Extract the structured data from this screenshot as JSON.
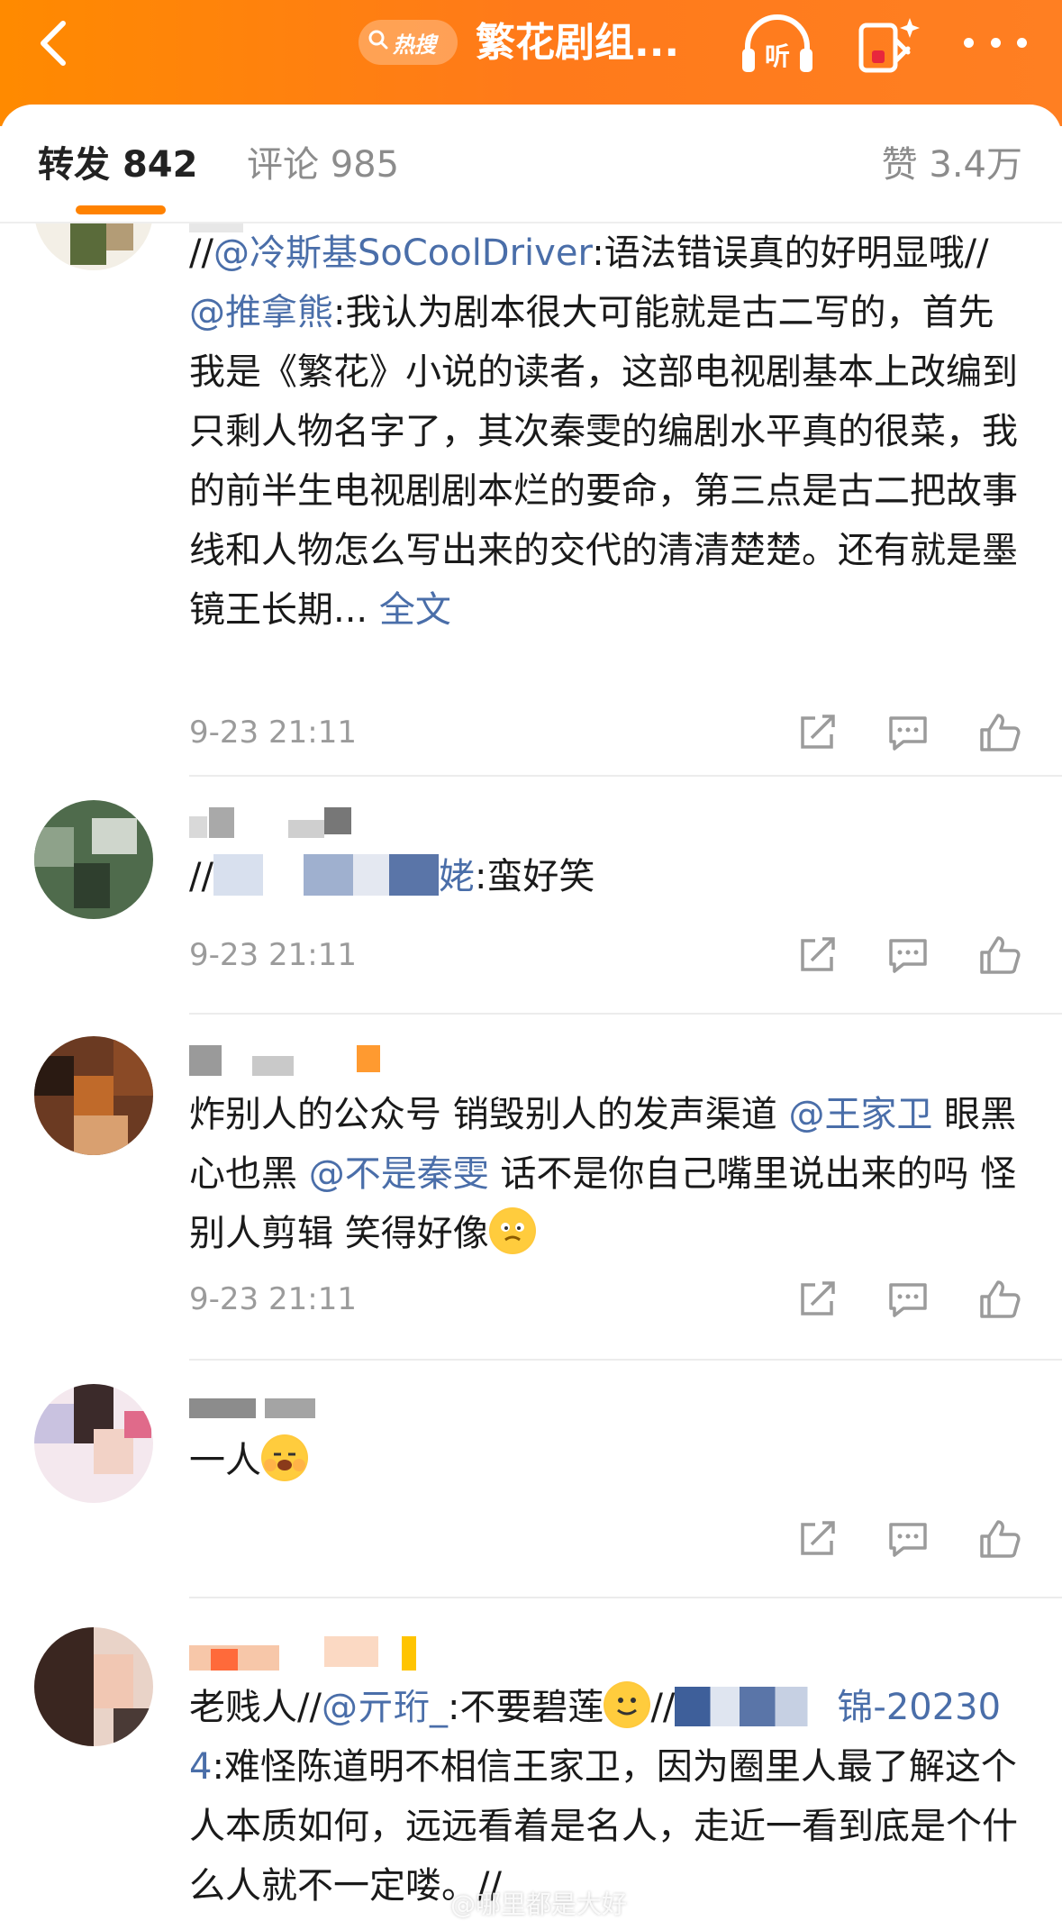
{
  "header": {
    "hot_label": "热搜",
    "title": "繁花剧组...",
    "listen_label": "听"
  },
  "tabs": {
    "repost_label": "转发",
    "repost_count": "842",
    "comment_label": "评论",
    "comment_count": "985",
    "like_label": "赞",
    "like_count": "3.4万"
  },
  "posts": [
    {
      "content_parts": [
        {
          "text": "//",
          "type": "text"
        },
        {
          "text": "@冷斯基SoCoolDriver",
          "type": "mention"
        },
        {
          "text": ":语法错误真的好明显哦//",
          "type": "text"
        },
        {
          "text": "@推拿熊",
          "type": "mention"
        },
        {
          "text": ":我认为剧本很大可能就是古二写的，首先我是《繁花》小说的读者，这部电视剧基本上改编到只剩人物名字了，其次秦雯的编剧水平真的很菜，我的前半生电视剧剧本烂的要命，第三点是古二把故事线和人物怎么写出来的交代的清清楚楚。还有就是墨镜王长期...",
          "type": "text"
        },
        {
          "text": " 全文",
          "type": "link"
        }
      ],
      "time": "9-23 21:11"
    },
    {
      "content_parts": [
        {
          "text": "//",
          "type": "text"
        },
        {
          "text": "姥",
          "type": "mention"
        },
        {
          "text": ":蛮好笑",
          "type": "text"
        }
      ],
      "time": "9-23 21:11"
    },
    {
      "content_parts": [
        {
          "text": "炸别人的公众号 销毁别人的发声渠道 ",
          "type": "text"
        },
        {
          "text": "@王家卫",
          "type": "mention"
        },
        {
          "text": " 眼黑心也黑 ",
          "type": "text"
        },
        {
          "text": "@不是秦雯",
          "type": "mention"
        },
        {
          "text": " 话不是你自己嘴里说出来的吗 怪别人剪辑 笑得好像",
          "type": "text"
        }
      ],
      "time": "9-23 21:11"
    },
    {
      "content_parts": [
        {
          "text": "一人",
          "type": "text"
        }
      ],
      "time": ""
    },
    {
      "content_parts": [
        {
          "text": "老贱人//",
          "type": "text"
        },
        {
          "text": "@亓珩_",
          "type": "mention"
        },
        {
          "text": ":不要碧莲",
          "type": "text"
        },
        {
          "text": "//",
          "type": "text"
        },
        {
          "text": "锦-202304",
          "type": "mention"
        },
        {
          "text": ":难怪陈道明不相信王家卫，因为圈里人最了解这个人本质如何，远远看着是名人，走近一看到底是个什么人就不一定喽。//",
          "type": "text"
        }
      ],
      "time": ""
    }
  ],
  "watermark": "@哪里都是大好",
  "colors": {
    "brand_orange": "#ff8200",
    "mention_blue": "#4a6ea9",
    "meta_gray": "#9b9b9b"
  },
  "icons": [
    "back-icon",
    "search-icon",
    "listen-icon",
    "redpacket-icon",
    "more-icon",
    "share-icon",
    "comment-icon",
    "like-icon"
  ]
}
